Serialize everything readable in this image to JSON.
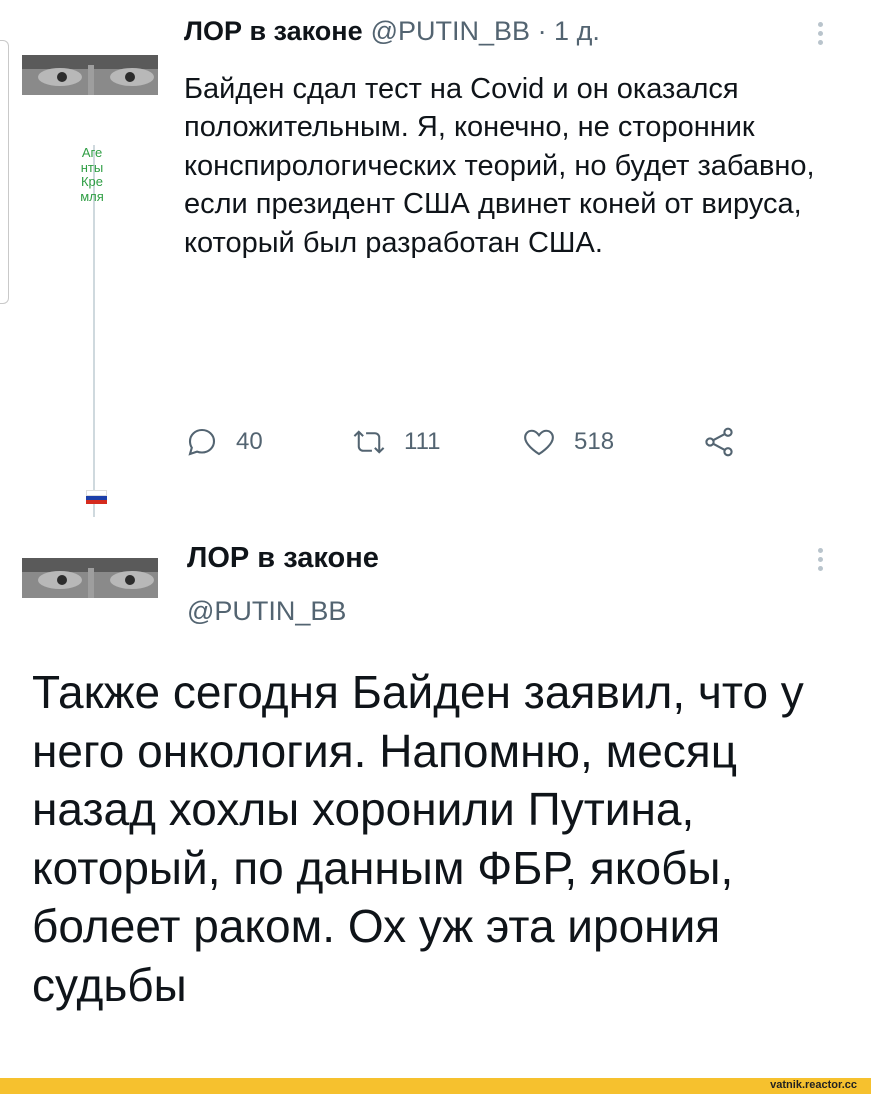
{
  "tweet1": {
    "author_name": "ЛОР в законе",
    "meta": "@PUTIN_BB · 1 д.",
    "text": "Байден сдал тест на Covid и он оказался положительным. Я, конечно, не сторонник конспирологических теорий, но будет забавно, если президент США двинет коней от вируса, который был разработан США.",
    "side_label": "Агенты Кремля",
    "actions": {
      "replies": "40",
      "retweets": "111",
      "likes": "518"
    }
  },
  "tweet2": {
    "author_name": "ЛОР в законе",
    "handle": "@PUTIN_BB",
    "text": "Также сегодня Байден заявил, что у него онкология. Напомню, месяц назад хохлы хоронили Путина, который, по данным ФБР, якобы, болеет раком. Ох уж эта ирония судьбы"
  },
  "watermark": "vatnik.reactor.cc",
  "colors": {
    "text": "#0f1419",
    "muted": "#536471",
    "thread_line": "#cfd9de",
    "side_label": "#2f9e44",
    "footer": "#f6c12e"
  }
}
